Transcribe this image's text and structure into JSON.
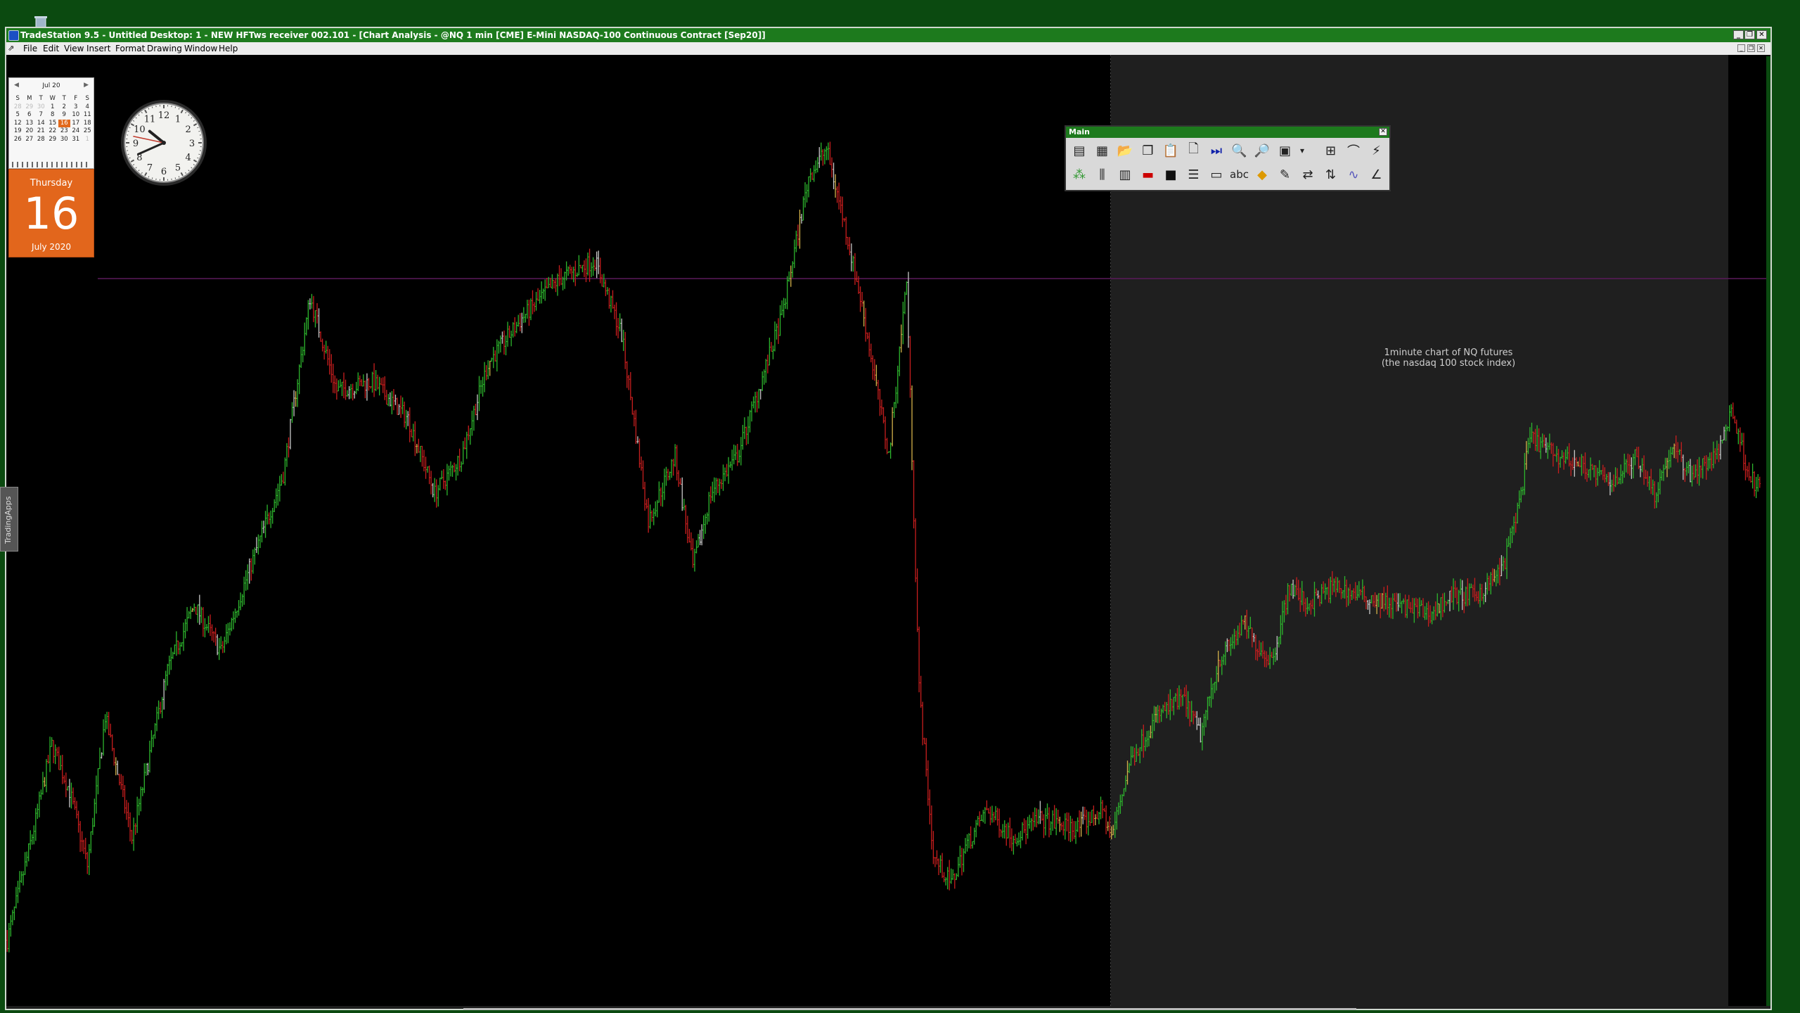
{
  "desktop": {
    "recycle_bin_icon": "recycle-bin-icon",
    "background": "#0b4a10"
  },
  "window": {
    "title": "TradeStation 9.5 - Untitled Desktop: 1 - NEW HFTws receiver 002.101 - [Chart Analysis - @NQ 1 min [CME] E-Mini NASDAQ-100 Continuous Contract [Sep20]]",
    "controls": {
      "minimize": "_",
      "restore": "❐",
      "close": "✕"
    }
  },
  "menu": {
    "items": [
      "File",
      "Edit",
      "View",
      "Insert",
      "Format",
      "Drawing",
      "Window",
      "Help"
    ]
  },
  "calendar": {
    "month": "Jul 20",
    "prev": "◀",
    "next": "▶",
    "weekdays": [
      "S",
      "M",
      "T",
      "W",
      "T",
      "F",
      "S"
    ],
    "days": [
      "28",
      "29",
      "30",
      "1",
      "2",
      "3",
      "4",
      "5",
      "6",
      "7",
      "8",
      "9",
      "10",
      "11",
      "12",
      "13",
      "14",
      "15",
      "16",
      "17",
      "18",
      "19",
      "20",
      "21",
      "22",
      "23",
      "24",
      "25",
      "26",
      "27",
      "28",
      "29",
      "30",
      "31",
      "1"
    ],
    "today": "16"
  },
  "date_card": {
    "weekday": "Thursday",
    "day": "16",
    "month_year": "July 2020"
  },
  "clock": {
    "numerals": [
      "12",
      "1",
      "2",
      "3",
      "4",
      "5",
      "6",
      "7",
      "8",
      "9",
      "10",
      "11"
    ],
    "hour": 10.3,
    "minute": 41,
    "second": 47
  },
  "side_tab": {
    "label": "TradingApps"
  },
  "toolbar": {
    "title": "Main",
    "close": "✕",
    "row1": [
      "chart-analysis-icon",
      "radar-screen-icon",
      "open-folder-icon",
      "copy-icon",
      "paste-icon",
      "new-page-icon",
      "skip-to-end-icon",
      "zoom-in-icon",
      "zoom-out-icon",
      "data-window-icon",
      "dropdown-icon",
      "insert-grid-icon",
      "curve-tool-icon",
      "fib-tool-icon"
    ],
    "row2": [
      "indicator-icon",
      "bar-style-icon",
      "format-window-icon",
      "symbol-color-icon",
      "camera-icon",
      "lines-icon",
      "rounded-rect-icon",
      "text-abc-icon",
      "eraser-icon",
      "pencil-icon",
      "order-line-icon",
      "trend-arrow-icon",
      "wave-icon",
      "angle-tool-icon"
    ],
    "abc_label": "abc"
  },
  "annotation": {
    "line1": "1minute chart of NQ futures",
    "line2": "(the nasdaq 100 stock index)"
  },
  "chart_data": {
    "type": "bar",
    "symbol": "@NQ 1 min",
    "colors": {
      "up": "#2db52d",
      "down": "#c81e1e",
      "neutral": "#c8c8c8",
      "highlight": "#d4b24a",
      "hline": "#5a1a5a"
    },
    "segments": [
      {
        "name": "left",
        "anchors": [
          [
            0,
            0.06
          ],
          [
            15,
            0.18
          ],
          [
            25,
            0.27
          ],
          [
            35,
            0.22
          ],
          [
            45,
            0.14
          ],
          [
            55,
            0.3
          ],
          [
            70,
            0.17
          ],
          [
            90,
            0.35
          ],
          [
            105,
            0.42
          ],
          [
            120,
            0.37
          ],
          [
            140,
            0.48
          ],
          [
            155,
            0.56
          ],
          [
            170,
            0.75
          ],
          [
            185,
            0.65
          ],
          [
            205,
            0.66
          ],
          [
            225,
            0.62
          ],
          [
            240,
            0.54
          ],
          [
            255,
            0.58
          ],
          [
            270,
            0.68
          ],
          [
            290,
            0.73
          ],
          [
            310,
            0.77
          ],
          [
            330,
            0.79
          ],
          [
            345,
            0.71
          ],
          [
            360,
            0.51
          ],
          [
            375,
            0.58
          ],
          [
            385,
            0.46
          ],
          [
            395,
            0.54
          ],
          [
            410,
            0.58
          ],
          [
            420,
            0.64
          ],
          [
            435,
            0.73
          ],
          [
            450,
            0.88
          ],
          [
            460,
            0.91
          ],
          [
            470,
            0.83
          ],
          [
            480,
            0.74
          ],
          [
            495,
            0.58
          ],
          [
            505,
            0.77
          ],
          [
            512,
            0.33
          ],
          [
            520,
            0.15
          ],
          [
            530,
            0.12
          ],
          [
            538,
            0.16
          ],
          [
            550,
            0.2
          ],
          [
            565,
            0.17
          ],
          [
            580,
            0.19
          ],
          [
            600,
            0.18
          ],
          [
            615,
            0.2
          ],
          [
            620,
            0.17
          ]
        ]
      },
      {
        "name": "right",
        "anchors": [
          [
            620,
            0.17
          ],
          [
            630,
            0.25
          ],
          [
            645,
            0.3
          ],
          [
            660,
            0.32
          ],
          [
            670,
            0.28
          ],
          [
            680,
            0.36
          ],
          [
            695,
            0.4
          ],
          [
            700,
            0.38
          ],
          [
            710,
            0.36
          ],
          [
            720,
            0.44
          ],
          [
            730,
            0.42
          ],
          [
            745,
            0.44
          ],
          [
            760,
            0.43
          ],
          [
            780,
            0.42
          ],
          [
            800,
            0.41
          ],
          [
            810,
            0.43
          ],
          [
            825,
            0.43
          ],
          [
            840,
            0.46
          ],
          [
            850,
            0.54
          ],
          [
            855,
            0.6
          ],
          [
            870,
            0.58
          ],
          [
            885,
            0.57
          ],
          [
            900,
            0.55
          ],
          [
            915,
            0.58
          ],
          [
            925,
            0.54
          ],
          [
            935,
            0.59
          ],
          [
            945,
            0.56
          ],
          [
            960,
            0.58
          ],
          [
            968,
            0.63
          ],
          [
            978,
            0.56
          ],
          [
            985,
            0.54
          ]
        ]
      }
    ],
    "bars": 985,
    "shade_start_bar": 620
  }
}
